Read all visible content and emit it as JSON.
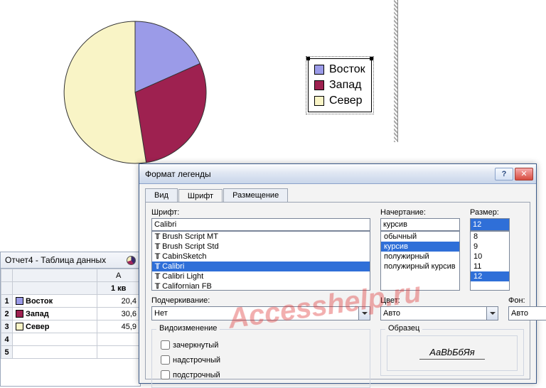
{
  "chart_data": {
    "type": "pie",
    "categories": [
      "Восток",
      "Запад",
      "Север"
    ],
    "values": [
      20.4,
      30.6,
      45.9
    ],
    "colors": [
      "#9b9be8",
      "#9e2150",
      "#f9f4c6"
    ],
    "title": "",
    "legend_position": "right"
  },
  "legend": {
    "items": [
      {
        "label": "Восток"
      },
      {
        "label": "Запад"
      },
      {
        "label": "Север"
      }
    ]
  },
  "datasheet": {
    "title": "Отчет4 - Таблица данных",
    "col_a_header": "A",
    "col_b_header": "1 кв",
    "rows": [
      {
        "n": "1",
        "name": "Восток",
        "val": "20,4"
      },
      {
        "n": "2",
        "name": "Запад",
        "val": "30,6"
      },
      {
        "n": "3",
        "name": "Север",
        "val": "45,9"
      },
      {
        "n": "4",
        "name": "",
        "val": ""
      },
      {
        "n": "5",
        "name": "",
        "val": ""
      }
    ]
  },
  "dialog": {
    "title": "Формат легенды",
    "tabs": {
      "view": "Вид",
      "font": "Шрифт",
      "placement": "Размещение"
    },
    "font_label": "Шрифт:",
    "font_value": "Calibri",
    "font_list": [
      "Brush Script MT",
      "Brush Script Std",
      "CabinSketch",
      "Calibri",
      "Calibri Light",
      "Californian FB"
    ],
    "font_selected_index": 3,
    "style_label": "Начертание:",
    "style_value": "курсив",
    "style_list": [
      "обычный",
      "курсив",
      "полужирный",
      "полужирный курсив"
    ],
    "style_selected_index": 1,
    "size_label": "Размер:",
    "size_value": "12",
    "size_list": [
      "8",
      "9",
      "10",
      "11",
      "12"
    ],
    "size_selected_index": 4,
    "underline_label": "Подчеркивание:",
    "underline_value": "Нет",
    "color_label": "Цвет:",
    "color_value": "Авто",
    "bg_label": "Фон:",
    "bg_value": "Авто",
    "effects_label": "Видоизменение",
    "effects": {
      "strike": "зачеркнутый",
      "super": "надстрочный",
      "sub": "подстрочный"
    },
    "sample_label": "Образец",
    "sample_text": "АаBbБбЯя"
  },
  "watermark": "Accesshelp.ru"
}
